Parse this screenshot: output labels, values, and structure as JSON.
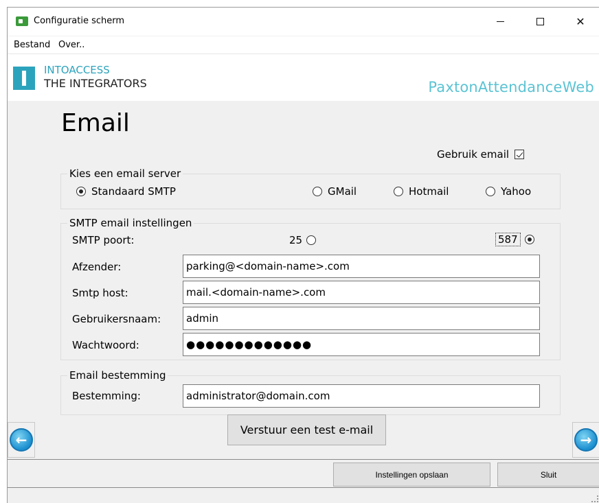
{
  "window": {
    "title": "Configuratie scherm",
    "minimize": "—",
    "maximize": "☐",
    "close": "✕"
  },
  "menu": {
    "items": [
      "Bestand",
      "Over.."
    ]
  },
  "header": {
    "brand_line1": "INTOACCESS",
    "brand_line2": "THE INTEGRATORS",
    "product": "PaxtonAttendanceWeb"
  },
  "page": {
    "title": "Email",
    "use_email_label": "Gebruik email",
    "use_email_checked": true
  },
  "server_group": {
    "legend": "Kies een email server",
    "options": [
      "Standaard SMTP",
      "GMail",
      "Hotmail",
      "Yahoo"
    ],
    "selected": "Standaard SMTP"
  },
  "smtp_group": {
    "legend": "SMTP email instellingen",
    "port_label": "SMTP poort:",
    "port_25": "25",
    "port_587": "587",
    "selected_port": "587",
    "sender_label": "Afzender:",
    "sender_value": "parking@<domain-name>.com",
    "host_label": "Smtp host:",
    "host_value": "mail.<domain-name>.com",
    "user_label": "Gebruikersnaam:",
    "user_value": "admin",
    "password_label": "Wachtwoord:",
    "password_value": "●●●●●●●●●●●●●"
  },
  "dest_group": {
    "legend": "Email bestemming",
    "dest_label": "Bestemming:",
    "dest_value": "administrator@domain.com"
  },
  "buttons": {
    "test": "Verstuur een test e-mail",
    "save": "Instellingen opslaan",
    "close": "Sluit",
    "prev_arrow": "←",
    "next_arrow": "→"
  }
}
